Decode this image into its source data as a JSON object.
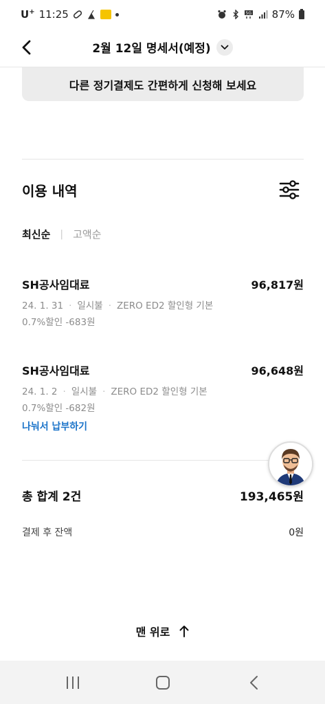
{
  "status_bar": {
    "carrier": "U",
    "carrier_sup": "+",
    "time": "11:25",
    "battery": "87%"
  },
  "header": {
    "title": "2월 12일 명세서(예정)",
    "back_icon": "chevron-left-icon",
    "dropdown_icon": "chevron-down-icon"
  },
  "promo": {
    "text": "다른 정기결제도 간편하게 신청해 보세요"
  },
  "usage": {
    "title": "이용 내역",
    "filter_icon": "sliders-icon",
    "sort": {
      "active": "최신순",
      "inactive": "고액순"
    },
    "transactions": [
      {
        "merchant": "SH공사임대료",
        "amount": "96,817원",
        "date": "24. 1. 31",
        "payment_type": "일시불",
        "card": "ZERO ED2 할인형 기본",
        "discount": "0.7%할인 -683원"
      },
      {
        "merchant": "SH공사임대료",
        "amount": "96,648원",
        "date": "24. 1. 2",
        "payment_type": "일시불",
        "card": "ZERO ED2 할인형 기본",
        "discount": "0.7%할인 -682원",
        "action": "나눠서 납부하기"
      }
    ]
  },
  "summary": {
    "total_label": "총 합계 2건",
    "total_value": "193,465원",
    "balance_label": "결제 후 잔액",
    "balance_value": "0원"
  },
  "to_top": {
    "label": "맨 위로",
    "icon": "arrow-up-icon"
  },
  "nav_bar": {
    "recent_icon": "recent-apps-icon",
    "home_icon": "home-icon",
    "back_icon": "back-icon"
  },
  "colors": {
    "link": "#1a73c9",
    "promo_bg": "#ececec",
    "muted": "#8c8c8c"
  }
}
